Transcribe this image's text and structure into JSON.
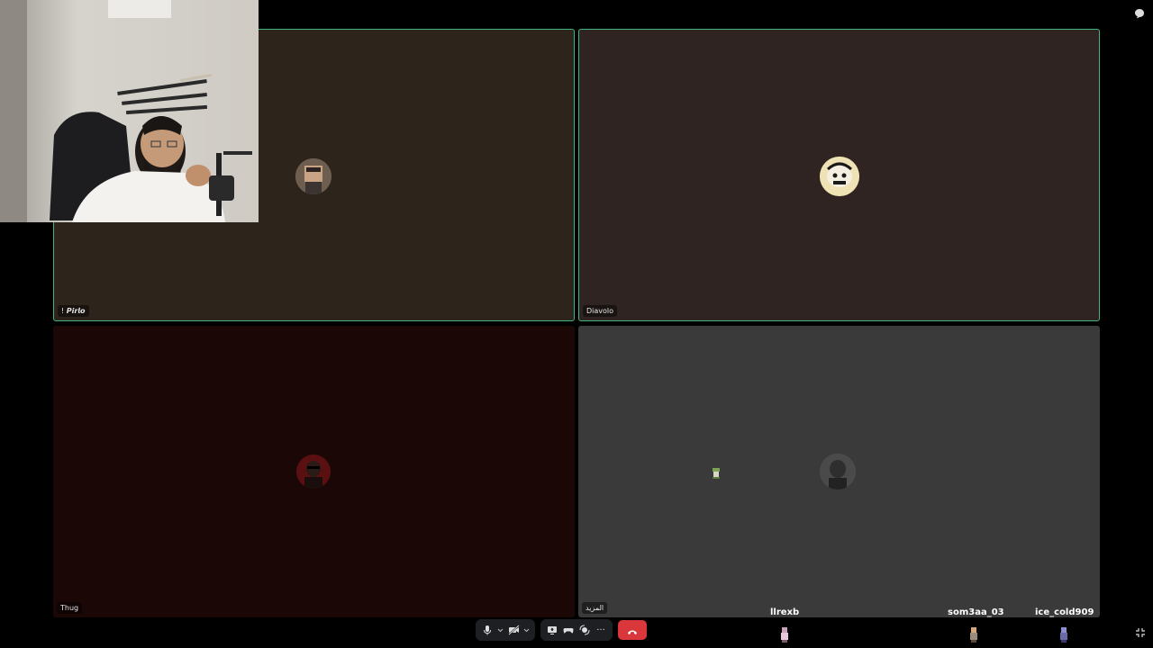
{
  "tiles": [
    {
      "id": "pirlo",
      "name": "! 𝙋𝙞𝙧𝙡𝙤"
    },
    {
      "id": "diavolo",
      "name": "Diavolo"
    },
    {
      "id": "thug",
      "name": "Thug"
    },
    {
      "id": "group",
      "name": "المزيد"
    }
  ],
  "viewers": [
    {
      "name": "llrexb"
    },
    {
      "name": "som3aa_03"
    },
    {
      "name": "ice_cold909"
    }
  ],
  "controls": {
    "mic": "microphone-icon",
    "camera": "camera-off-icon",
    "screen": "screen-share-icon",
    "activity": "controller-icon",
    "soundboard": "soundboard-icon",
    "more": "ellipsis-icon",
    "hangup": "phone-hangup-icon",
    "more_label": "···"
  },
  "colors": {
    "speaking_border": "#43b581",
    "hangup": "#da373c"
  }
}
